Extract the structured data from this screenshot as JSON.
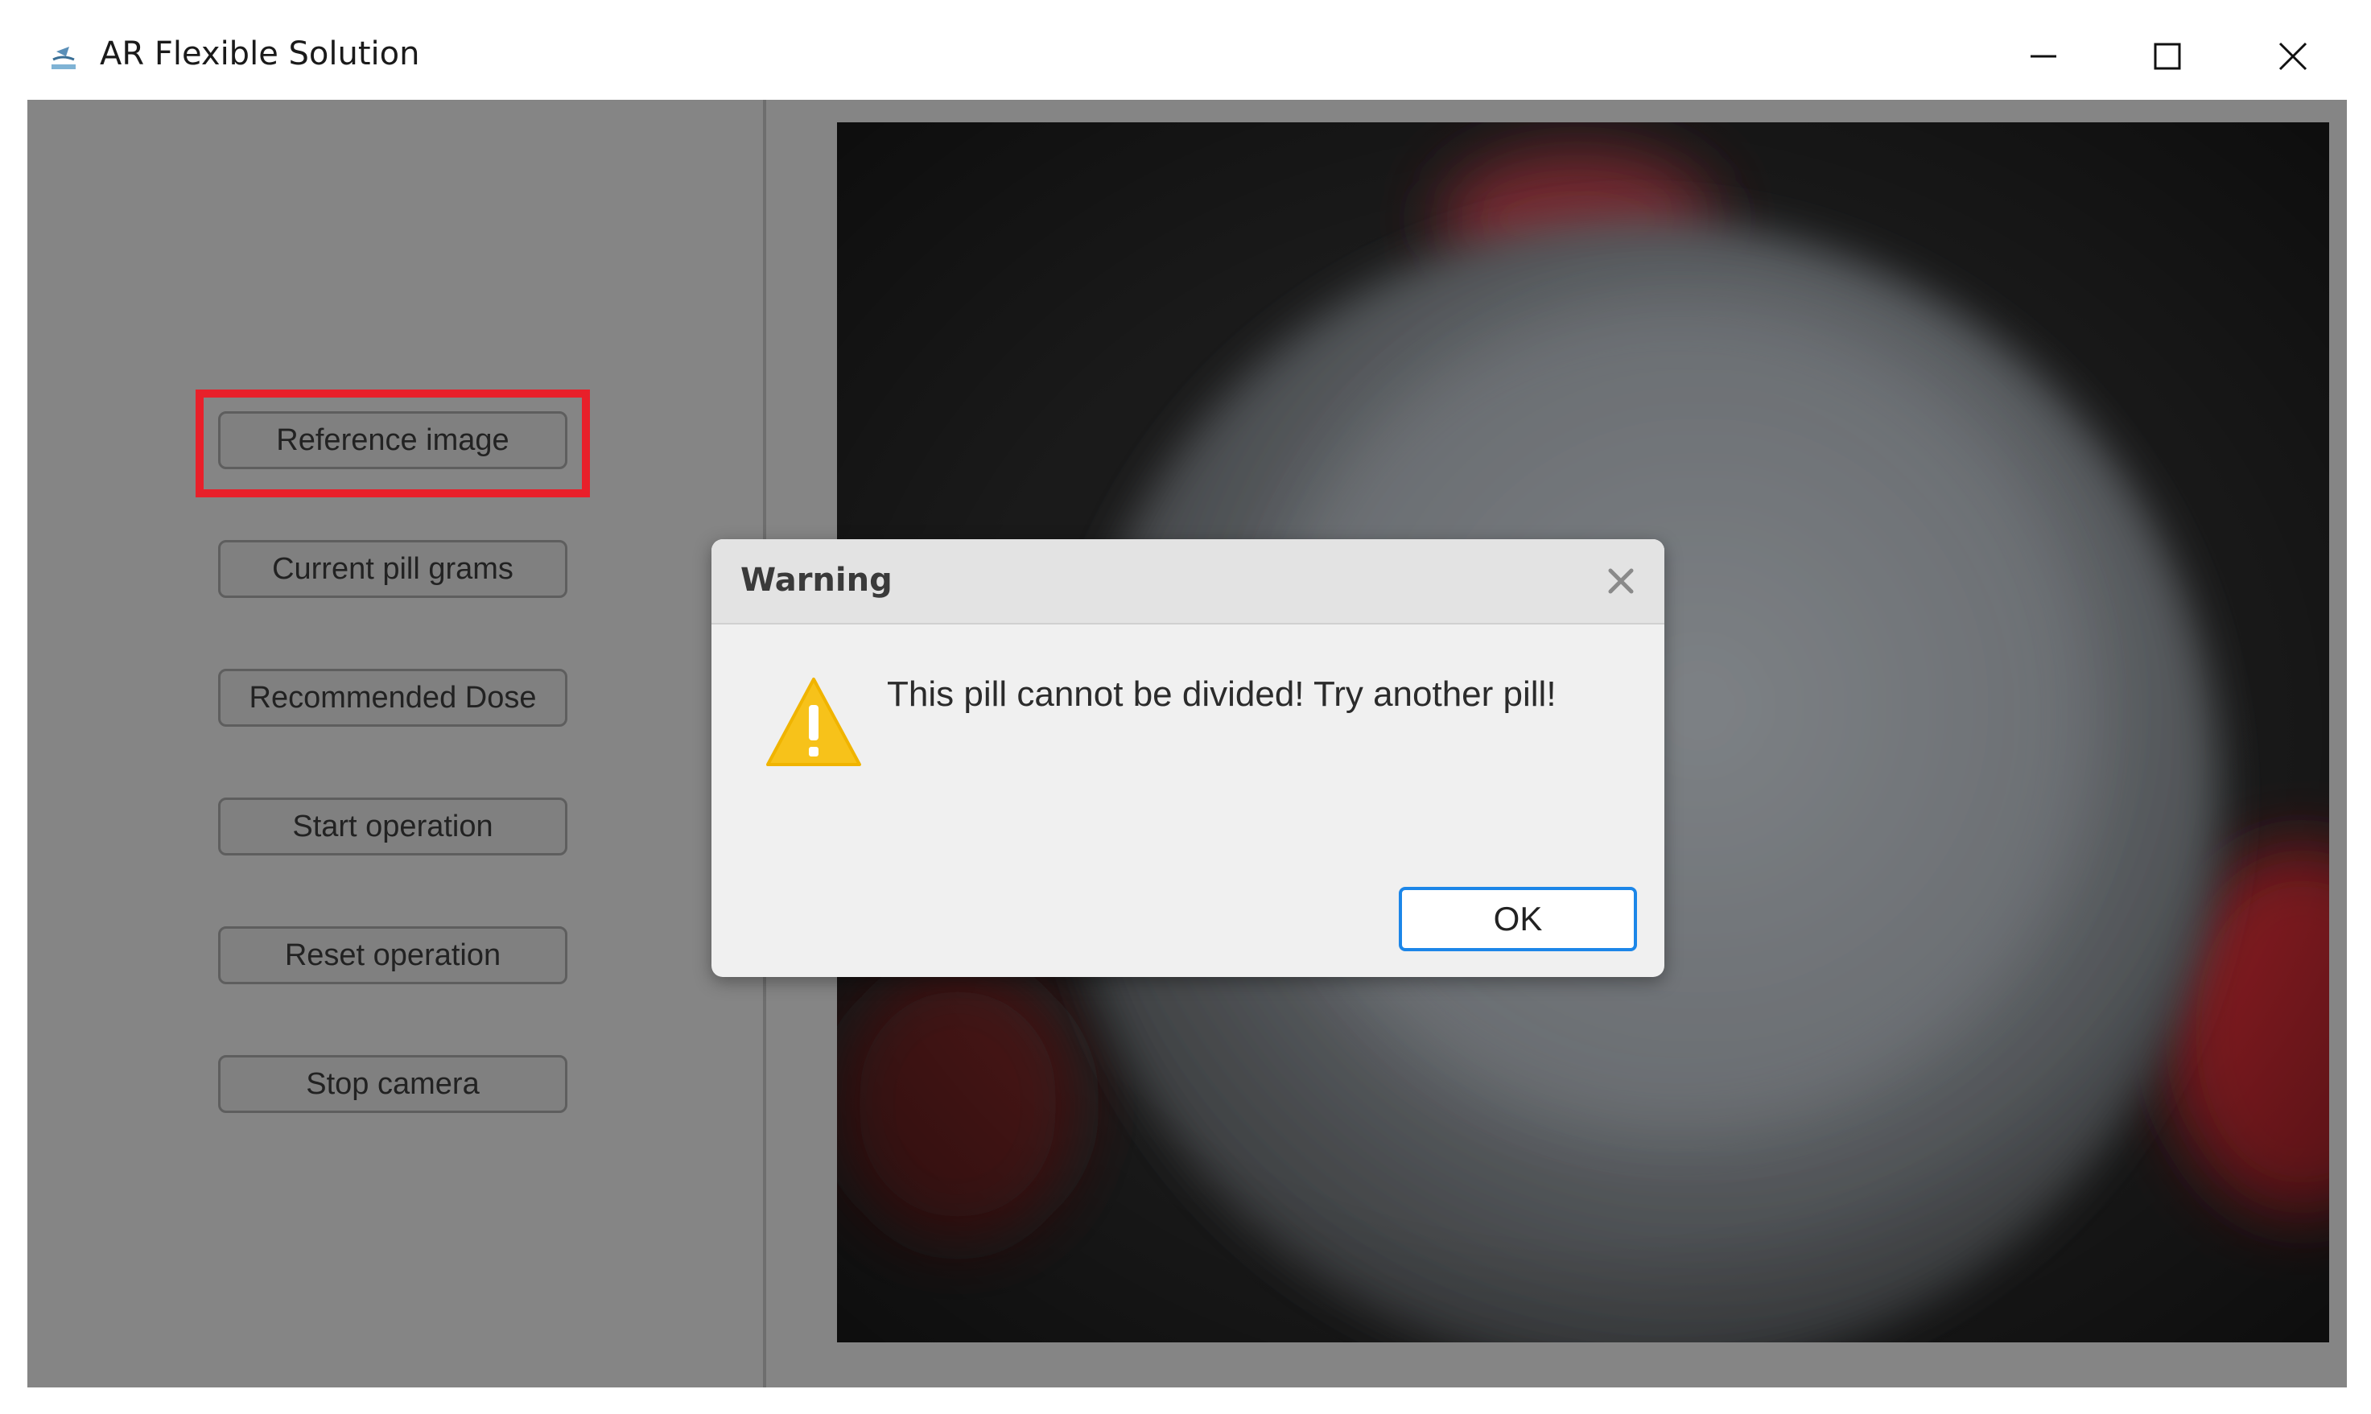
{
  "window": {
    "title": "AR Flexible Solution",
    "icon": "app-logo-icon",
    "controls": [
      "minimize-icon",
      "maximize-icon",
      "close-icon"
    ]
  },
  "sidebar": {
    "buttons": [
      {
        "label": "Reference image",
        "highlighted": true
      },
      {
        "label": "Current pill grams"
      },
      {
        "label": "Recommended Dose"
      },
      {
        "label": "Start operation"
      },
      {
        "label": "Reset operation"
      },
      {
        "label": "Stop camera"
      }
    ]
  },
  "dialog": {
    "title": "Warning",
    "message": "This pill cannot be divided! Try another pill!",
    "ok_label": "OK",
    "icon": "warning-triangle-icon"
  },
  "colors": {
    "highlight": "#e8202a",
    "ok_border": "#1c86e8",
    "warning_icon": "#f7c21a",
    "overlay_gray": "#858585"
  }
}
